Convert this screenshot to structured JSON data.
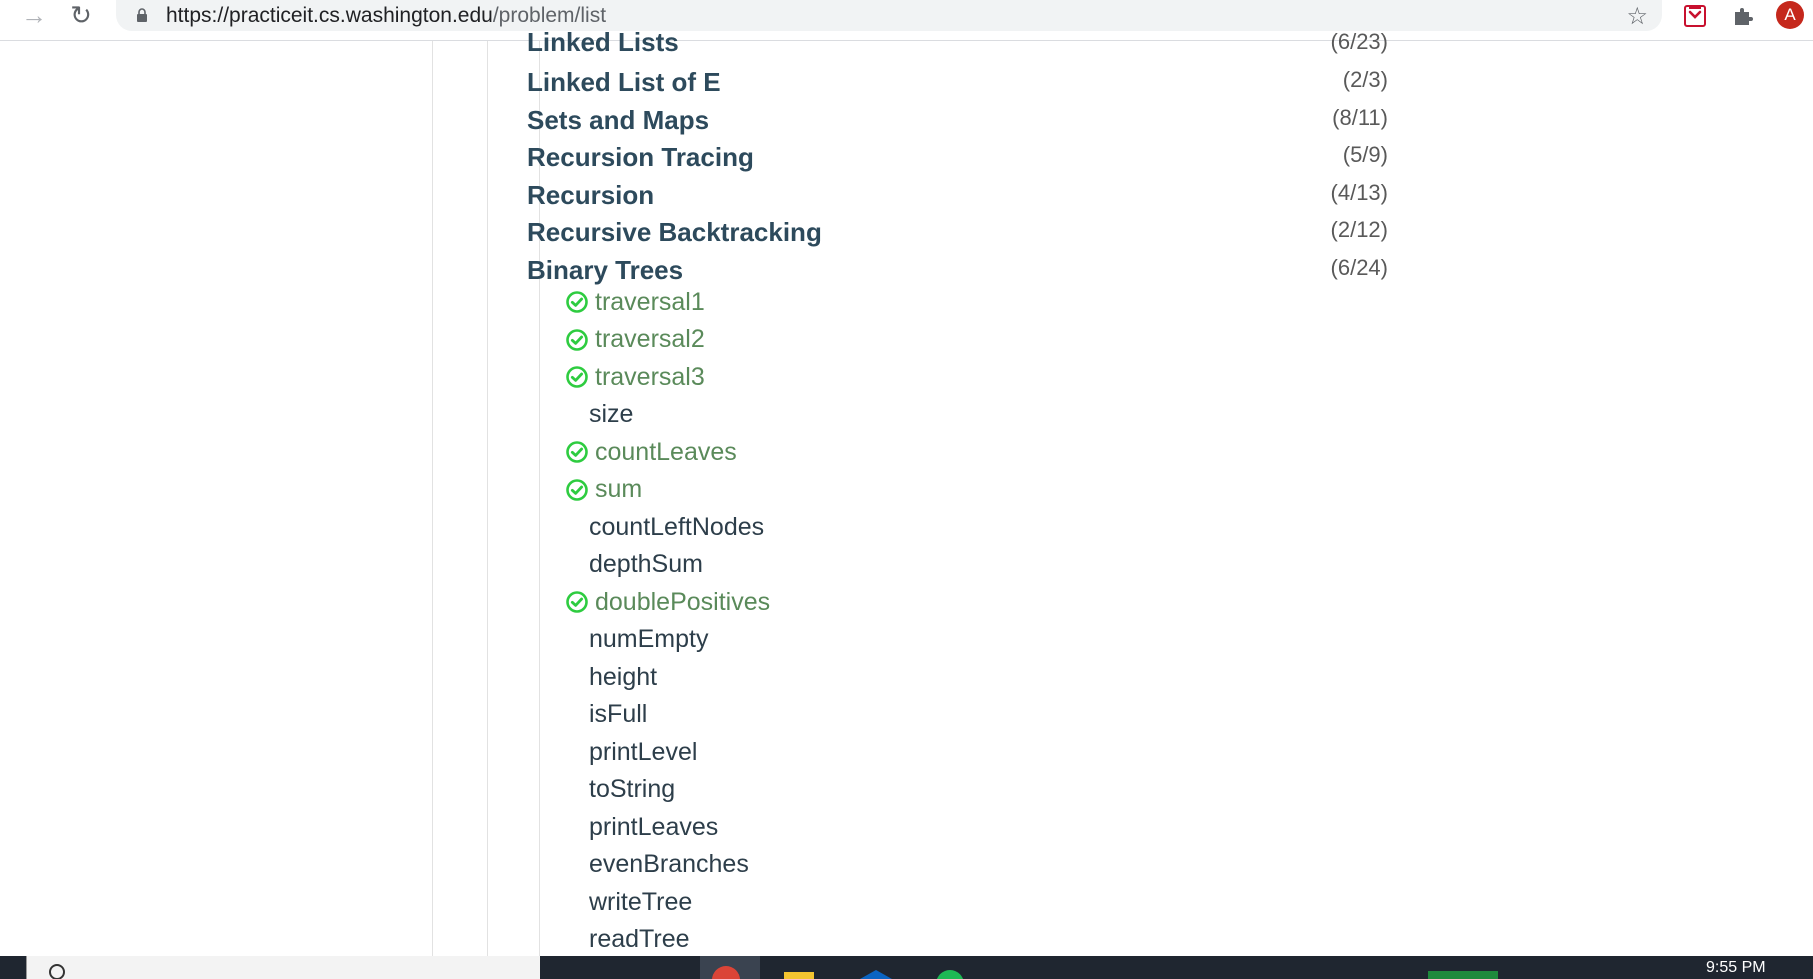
{
  "browser": {
    "url_host": "https://practiceit.cs.washington.edu",
    "url_path": "/problem/list",
    "avatar_letter": "A"
  },
  "topics": [
    {
      "name": "Linked Lists",
      "count": "(6/23)"
    },
    {
      "name": "Linked List of E",
      "count": "(2/3)"
    },
    {
      "name": "Sets and Maps",
      "count": "(8/11)"
    },
    {
      "name": "Recursion Tracing",
      "count": "(5/9)"
    },
    {
      "name": "Recursion",
      "count": "(4/13)"
    },
    {
      "name": "Recursive Backtracking",
      "count": "(2/12)"
    },
    {
      "name": "Binary Trees",
      "count": "(6/24)"
    }
  ],
  "problems": [
    {
      "name": "traversal1",
      "solved": true
    },
    {
      "name": "traversal2",
      "solved": true
    },
    {
      "name": "traversal3",
      "solved": true
    },
    {
      "name": "size",
      "solved": false
    },
    {
      "name": "countLeaves",
      "solved": true
    },
    {
      "name": "sum",
      "solved": true
    },
    {
      "name": "countLeftNodes",
      "solved": false
    },
    {
      "name": "depthSum",
      "solved": false
    },
    {
      "name": "doublePositives",
      "solved": true
    },
    {
      "name": "numEmpty",
      "solved": false
    },
    {
      "name": "height",
      "solved": false
    },
    {
      "name": "isFull",
      "solved": false
    },
    {
      "name": "printLevel",
      "solved": false
    },
    {
      "name": "toString",
      "solved": false
    },
    {
      "name": "printLeaves",
      "solved": false
    },
    {
      "name": "evenBranches",
      "solved": false
    },
    {
      "name": "writeTree",
      "solved": false
    },
    {
      "name": "readTree",
      "solved": false
    }
  ],
  "taskbar": {
    "clock": "9:55 PM"
  },
  "colors": {
    "topic_text": "#2d4a5c",
    "solved_text": "#5a8a5a",
    "check_green": "#2ecc40",
    "avatar_bg": "#c5281c"
  }
}
